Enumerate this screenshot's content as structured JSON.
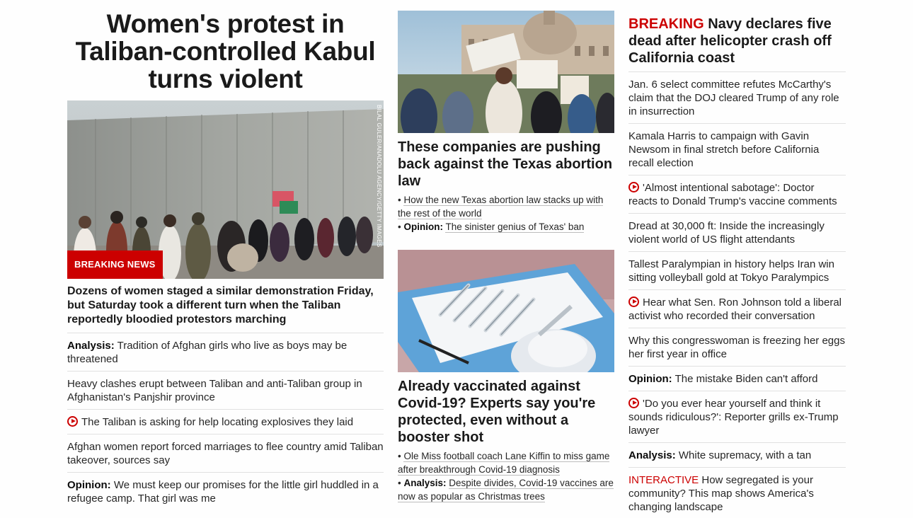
{
  "lead": {
    "headline": "Women's protest in Taliban-controlled Kabul turns violent",
    "photo_credit": "BILAL GULER/ANADOLU AGENCY/GETTY IMAGES",
    "badge": "BREAKING NEWS",
    "subhead": "Dozens of women staged a similar demonstration Friday, but Saturday took a different turn when the Taliban reportedly bloodied protestors marching",
    "stories": [
      {
        "prefix": "Analysis:",
        "text": "Tradition of Afghan girls who live as boys may be threatened",
        "video": false
      },
      {
        "prefix": "",
        "text": "Heavy clashes erupt between Taliban and anti-Taliban group in Afghanistan's Panjshir province",
        "video": false
      },
      {
        "prefix": "",
        "text": "The Taliban is asking for help locating explosives they laid",
        "video": true
      },
      {
        "prefix": "",
        "text": "Afghan women report forced marriages to flee country amid Taliban takeover, sources say",
        "video": false
      },
      {
        "prefix": "Opinion:",
        "text": "We must keep our promises for the little girl huddled in a refugee camp. That girl was me",
        "video": false
      }
    ]
  },
  "middle": [
    {
      "headline": "These companies are pushing back against the Texas abortion law",
      "image_icon": "protest-photo",
      "bullets": [
        {
          "prefix": "",
          "text": "How the new Texas abortion law stacks up with the rest of the world"
        },
        {
          "prefix": "Opinion:",
          "text": "The sinister genius of Texas' ban"
        }
      ]
    },
    {
      "headline": "Already vaccinated against Covid-19? Experts say you're protected, even without a booster shot",
      "image_icon": "syringe-photo",
      "bullets": [
        {
          "prefix": "",
          "text": "Ole Miss football coach Lane Kiffin to miss game after breakthrough Covid-19 diagnosis"
        },
        {
          "prefix": "Analysis:",
          "text": "Despite divides, Covid-19 vaccines are now as popular as Christmas trees"
        }
      ]
    }
  ],
  "right": {
    "breaking_label": "BREAKING",
    "breaking_headline": "Navy declares five dead after helicopter crash off California coast",
    "stories": [
      {
        "prefix": "",
        "red": "",
        "text": "Jan. 6 select committee refutes McCarthy's claim that the DOJ cleared Trump of any role in insurrection",
        "video": false
      },
      {
        "prefix": "",
        "red": "",
        "text": "Kamala Harris to campaign with Gavin Newsom in final stretch before California recall election",
        "video": false
      },
      {
        "prefix": "",
        "red": "",
        "text": "'Almost intentional sabotage': Doctor reacts to Donald Trump's vaccine comments",
        "video": true
      },
      {
        "prefix": "",
        "red": "",
        "text": "Dread at 30,000 ft: Inside the increasingly violent world of US flight attendants",
        "video": false
      },
      {
        "prefix": "",
        "red": "",
        "text": "Tallest Paralympian in history helps Iran win sitting volleyball gold at Tokyo Paralympics",
        "video": false
      },
      {
        "prefix": "",
        "red": "",
        "text": "Hear what Sen. Ron Johnson told a liberal activist who recorded their conversation",
        "video": true
      },
      {
        "prefix": "",
        "red": "",
        "text": "Why this congresswoman is freezing her eggs her first year in office",
        "video": false
      },
      {
        "prefix": "Opinion:",
        "red": "",
        "text": "The mistake Biden can't afford",
        "video": false
      },
      {
        "prefix": "",
        "red": "",
        "text": "'Do you ever hear yourself and think it sounds ridiculous?': Reporter grills ex-Trump lawyer",
        "video": true
      },
      {
        "prefix": "Analysis:",
        "red": "",
        "text": "White supremacy, with a tan",
        "video": false
      },
      {
        "prefix": "",
        "red": "INTERACTIVE",
        "text": "How segregated is your community? This map shows America's changing landscape",
        "video": false
      }
    ]
  },
  "colors": {
    "accent": "#cc0000",
    "rule": "#e1e1e1",
    "text": "#262626"
  }
}
